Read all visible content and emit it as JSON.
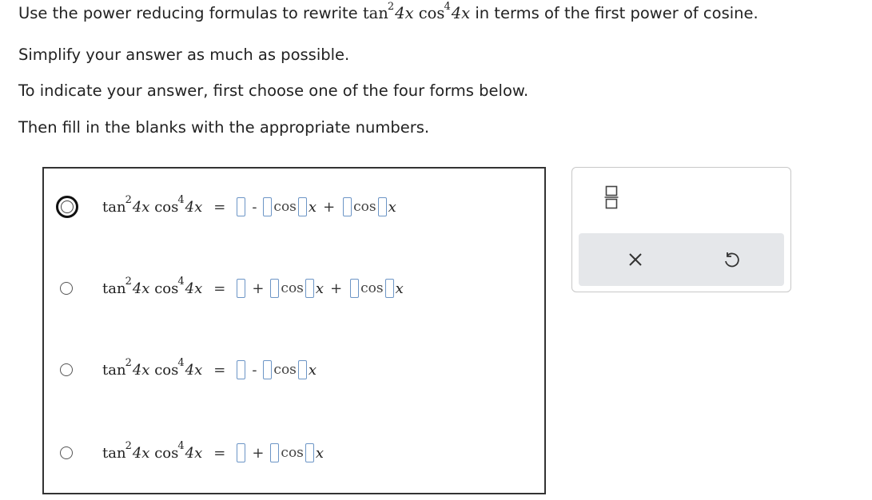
{
  "instructions": {
    "line1_prefix": "Use the power reducing formulas to rewrite",
    "line1_math_tan": "tan",
    "line1_math_exp2": "2",
    "line1_math_arg1": "4x",
    "line1_math_cos": "cos",
    "line1_math_exp4": "4",
    "line1_math_arg2": "4x",
    "line1_suffix": "in terms of the first power of cosine.",
    "line2": "Simplify your answer as much as possible.",
    "line3": "To indicate your answer, first choose one of the four forms below.",
    "line4": "Then fill in the blanks with the appropriate numbers."
  },
  "lhs": {
    "tan": "tan",
    "exp2": "2",
    "arg1": "4x",
    "cos": "cos",
    "exp4": "4",
    "arg2": "4x",
    "equals": "="
  },
  "options": [
    {
      "selected": true,
      "ops": [
        "-",
        "+"
      ],
      "terms": 3
    },
    {
      "selected": false,
      "ops": [
        "+",
        "+"
      ],
      "terms": 3
    },
    {
      "selected": false,
      "ops": [
        "-"
      ],
      "terms": 2
    },
    {
      "selected": false,
      "ops": [
        "+"
      ],
      "terms": 2
    }
  ],
  "cos_word": "cos",
  "x_var": "x",
  "op_minus": "-",
  "op_plus": "+",
  "toolbar": {
    "fraction_icon": "fraction-icon",
    "clear_icon": "close-icon",
    "undo_icon": "undo-icon"
  },
  "colors": {
    "slot_border": "#6c95c6",
    "toolbar_bg": "#e5e7ea"
  }
}
